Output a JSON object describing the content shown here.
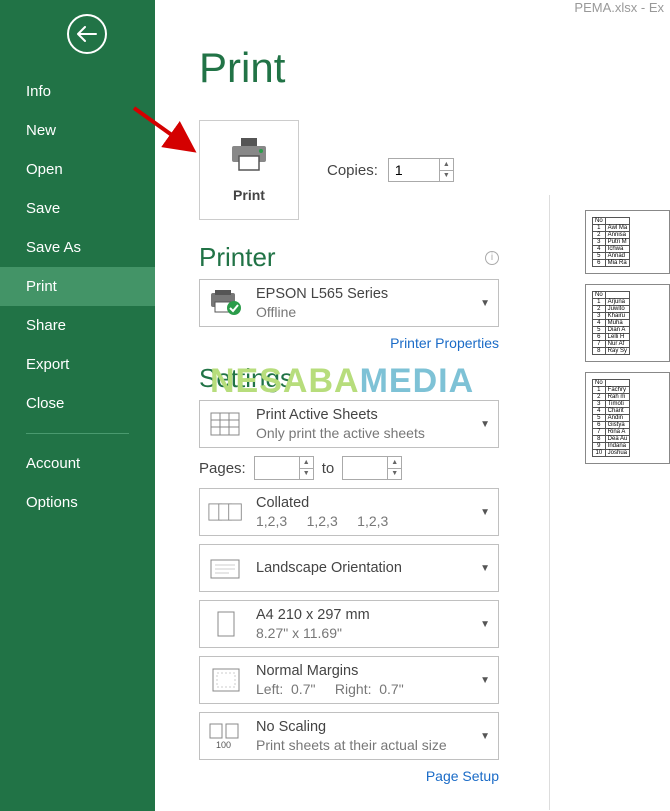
{
  "titlebar": "PEMA.xlsx - Ex",
  "sidebar": {
    "items": [
      "Info",
      "New",
      "Open",
      "Save",
      "Save As",
      "Print",
      "Share",
      "Export",
      "Close"
    ],
    "active_index": 5,
    "footer": [
      "Account",
      "Options"
    ]
  },
  "page": {
    "title": "Print"
  },
  "print_button": {
    "label": "Print"
  },
  "copies": {
    "label": "Copies:",
    "value": "1"
  },
  "printer": {
    "section_title": "Printer",
    "name": "EPSON L565 Series",
    "status": "Offline",
    "properties_link": "Printer Properties"
  },
  "settings": {
    "section_title": "Settings",
    "sheets": {
      "line1": "Print Active Sheets",
      "line2": "Only print the active sheets"
    },
    "pages": {
      "label": "Pages:",
      "to": "to",
      "from": "",
      "until": ""
    },
    "collate": {
      "line1": "Collated",
      "line2": "1,2,3     1,2,3     1,2,3"
    },
    "orientation": {
      "line1": "Landscape Orientation"
    },
    "paper": {
      "line1": "A4 210 x 297 mm",
      "line2": "8.27\" x 11.69\""
    },
    "margins": {
      "line1": "Normal Margins",
      "line2": "Left:  0.7\"     Right:  0.7\""
    },
    "scaling": {
      "line1": "No Scaling",
      "line2": "Print sheets at their actual size"
    },
    "page_setup_link": "Page Setup"
  },
  "preview_tables": [
    {
      "header": "No",
      "rows": [
        [
          "1",
          "Awl Ma"
        ],
        [
          "2",
          "Annisa"
        ],
        [
          "3",
          "Putri M"
        ],
        [
          "4",
          "Ichwa"
        ],
        [
          "5",
          "Annad"
        ],
        [
          "6",
          "Mia Ra"
        ]
      ]
    },
    {
      "header": "No",
      "rows": [
        [
          "1",
          "Arjuna"
        ],
        [
          "2",
          "Juwito"
        ],
        [
          "3",
          "Khairu"
        ],
        [
          "4",
          "Muha"
        ],
        [
          "5",
          "Dian A"
        ],
        [
          "6",
          "Lelli H"
        ],
        [
          "7",
          "Nur Af"
        ],
        [
          "8",
          "Ray Sy"
        ]
      ]
    },
    {
      "header": "No",
      "rows": [
        [
          "1",
          "Fachry"
        ],
        [
          "2",
          "Rah m"
        ],
        [
          "3",
          "Timoti"
        ],
        [
          "4",
          "Charit"
        ],
        [
          "5",
          "Andin"
        ],
        [
          "6",
          "Gistya"
        ],
        [
          "7",
          "Rina A"
        ],
        [
          "8",
          "Dea Au"
        ],
        [
          "9",
          "Indana"
        ],
        [
          "10",
          "Joshua"
        ]
      ]
    }
  ],
  "watermark": {
    "part1": "NESABA",
    "part2": "MEDIA"
  }
}
